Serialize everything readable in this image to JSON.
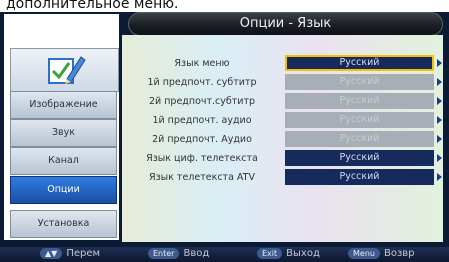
{
  "caption": "дополнительное меню.",
  "title": "Опции - Язык",
  "sidebar": {
    "items": [
      {
        "label": "Изображение",
        "active": false
      },
      {
        "label": "Звук",
        "active": false
      },
      {
        "label": "Канал",
        "active": false
      },
      {
        "label": "Опции",
        "active": true
      },
      {
        "label": "Установка",
        "active": false
      }
    ]
  },
  "rows": [
    {
      "label": "Язык меню",
      "value": "Русский",
      "state": "selected"
    },
    {
      "label": "1й предпочт. субтитр",
      "value": "Русский",
      "state": "disabled"
    },
    {
      "label": "2й предпочт.субтитр",
      "value": "Русский",
      "state": "disabled"
    },
    {
      "label": "1й предпочт. аудио",
      "value": "Русский",
      "state": "disabled"
    },
    {
      "label": "2й предпочт. Аудио",
      "value": "Русский",
      "state": "disabled"
    },
    {
      "label": "Язык циф. телетекста",
      "value": "Русский",
      "state": "enabled"
    },
    {
      "label": "Язык телетекста ATV",
      "value": "Русский",
      "state": "enabled"
    }
  ],
  "hints": [
    {
      "key": "▲▼",
      "label": "Перем"
    },
    {
      "key": "Enter",
      "label": "Ввод"
    },
    {
      "key": "Exit",
      "label": "Выход"
    },
    {
      "key": "Menu",
      "label": "Возвр"
    }
  ],
  "colors": {
    "selected_border": "#f2c200",
    "enabled_value_bg": "#162a5c",
    "disabled_value_bg": "#a7aeb5",
    "active_tab": "#2f7cdc"
  }
}
